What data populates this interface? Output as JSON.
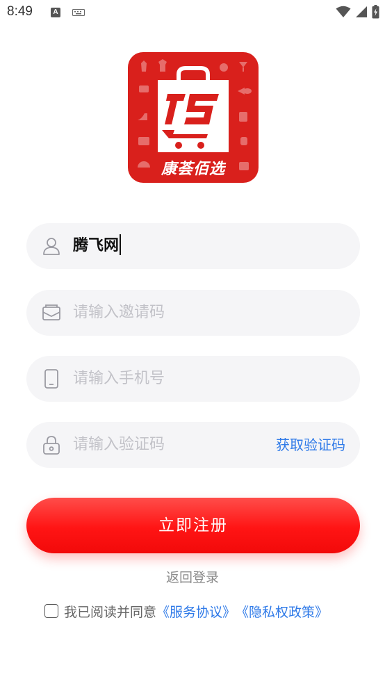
{
  "status_bar": {
    "time": "8:49",
    "notification_icon": "A"
  },
  "logo": {
    "brand_text": "康荟佰选",
    "brand_color": "#d9201c"
  },
  "form": {
    "username": {
      "value": "腾飞网",
      "icon": "user-icon"
    },
    "invite_code": {
      "placeholder": "请输入邀请码",
      "icon": "envelope-icon"
    },
    "phone": {
      "placeholder": "请输入手机号",
      "icon": "phone-icon"
    },
    "verify_code": {
      "placeholder": "请输入验证码",
      "icon": "lock-icon",
      "get_code_label": "获取验证码"
    }
  },
  "actions": {
    "register_label": "立即注册",
    "back_login_label": "返回登录"
  },
  "agreement": {
    "prefix": "我已阅读并同意",
    "service_link": "《服务协议》",
    "privacy_link": "《隐私权政策》",
    "checked": false
  },
  "colors": {
    "accent_red": "#ff1414",
    "link_blue": "#2f7ae8",
    "field_bg": "#f5f5f7"
  }
}
